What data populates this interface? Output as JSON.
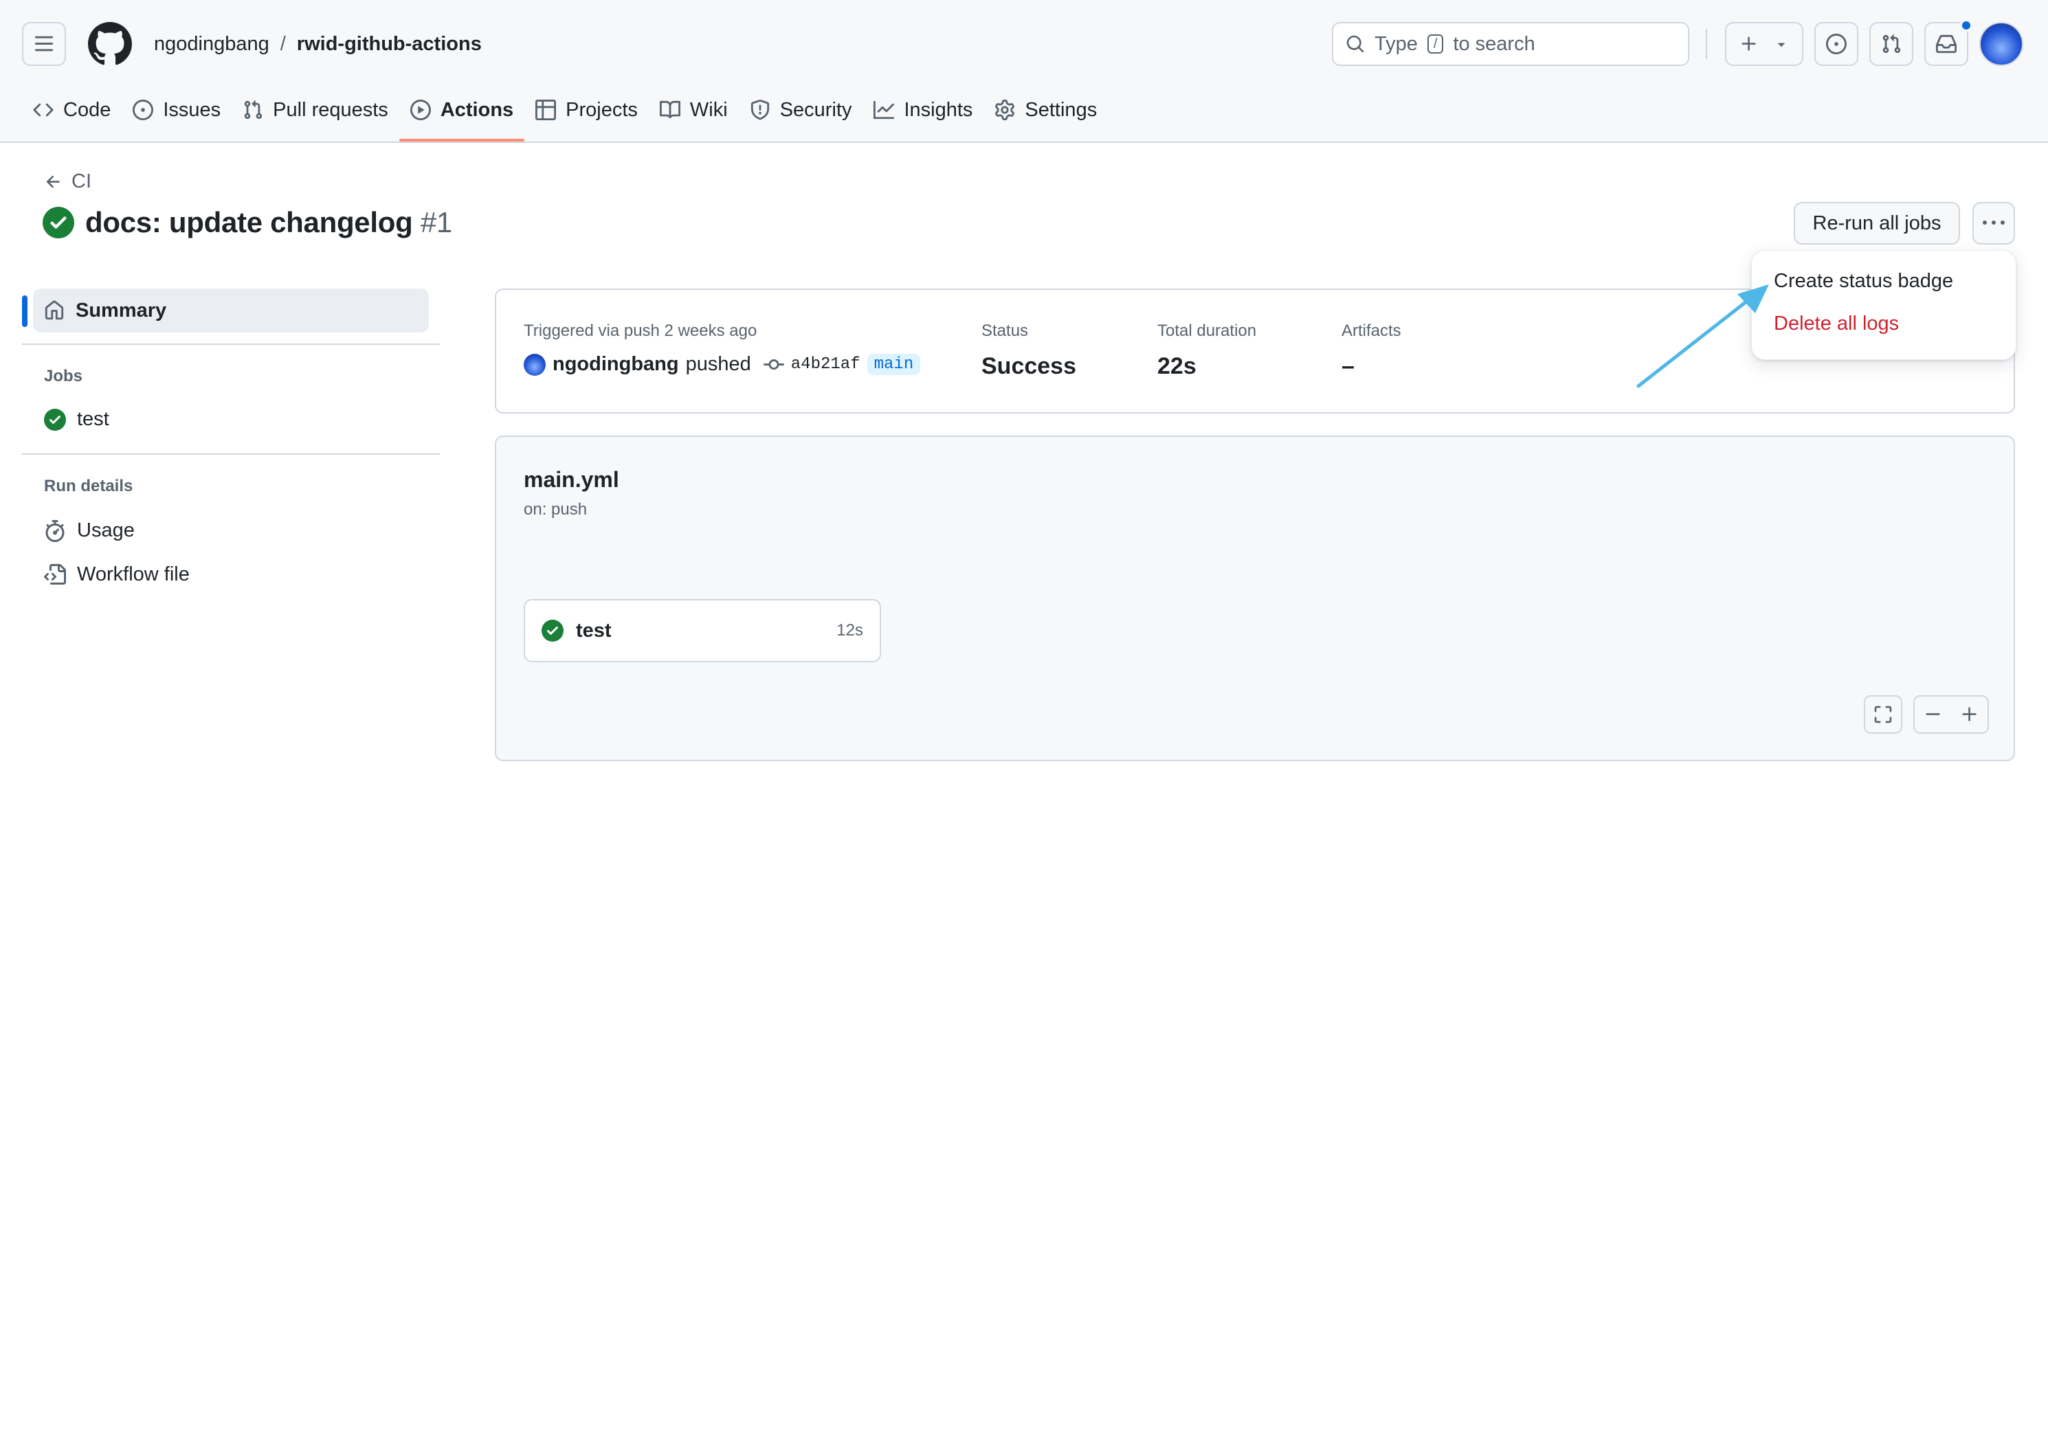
{
  "header": {
    "owner": "ngodingbang",
    "separator": "/",
    "repo": "rwid-github-actions",
    "search_prefix": "Type",
    "search_key": "/",
    "search_suffix": "to search"
  },
  "repo_nav": [
    {
      "label": "Code",
      "icon": "code-icon"
    },
    {
      "label": "Issues",
      "icon": "issue-opened-icon"
    },
    {
      "label": "Pull requests",
      "icon": "git-pull-request-icon"
    },
    {
      "label": "Actions",
      "icon": "play-icon",
      "active": true
    },
    {
      "label": "Projects",
      "icon": "table-icon"
    },
    {
      "label": "Wiki",
      "icon": "book-icon"
    },
    {
      "label": "Security",
      "icon": "shield-icon"
    },
    {
      "label": "Insights",
      "icon": "graph-icon"
    },
    {
      "label": "Settings",
      "icon": "gear-icon"
    }
  ],
  "run": {
    "back_label": "CI",
    "title": "docs: update changelog",
    "number": "#1",
    "rerun_label": "Re-run all jobs"
  },
  "menu": {
    "create_badge": "Create status badge",
    "delete_logs": "Delete all logs"
  },
  "sidebar": {
    "summary": "Summary",
    "jobs_heading": "Jobs",
    "job_name": "test",
    "run_details_heading": "Run details",
    "usage": "Usage",
    "workflow_file": "Workflow file"
  },
  "info": {
    "trigger": "Triggered via push 2 weeks ago",
    "actor": "ngodingbang",
    "action": "pushed",
    "sha": "a4b21af",
    "branch": "main",
    "status_label": "Status",
    "status_value": "Success",
    "duration_label": "Total duration",
    "duration_value": "22s",
    "artifacts_label": "Artifacts",
    "artifacts_value": "–"
  },
  "graph": {
    "file": "main.yml",
    "trigger": "on: push",
    "job_name": "test",
    "job_duration": "12s"
  },
  "colors": {
    "accent": "#0969da",
    "success": "#1a7f37",
    "danger": "#cf222e",
    "tab_underline": "#fd8c73",
    "annotation_arrow": "#4fb6e8"
  }
}
